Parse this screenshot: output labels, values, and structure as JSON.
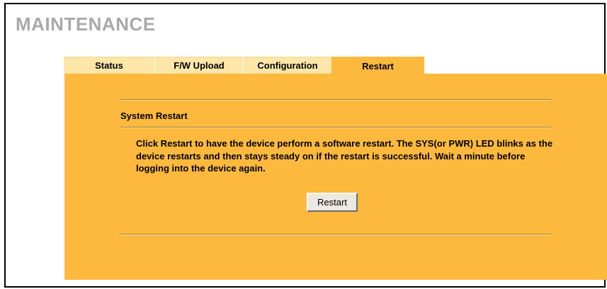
{
  "header": {
    "title": "MAINTENANCE"
  },
  "tabs": [
    {
      "label": "Status",
      "active": false
    },
    {
      "label": "F/W Upload",
      "active": false
    },
    {
      "label": "Configuration",
      "active": false
    },
    {
      "label": "Restart",
      "active": true
    }
  ],
  "restart": {
    "section_title": "System Restart",
    "description": "Click Restart to have the device perform a software restart. The SYS(or PWR) LED blinks as the device restarts and then stays steady on if the restart is successful. Wait a minute before logging into the device again.",
    "button_label": "Restart"
  },
  "colors": {
    "panel": "#fdb93d",
    "inactive_tab": "#fde6a8",
    "title_gray": "#a9a9a9"
  }
}
